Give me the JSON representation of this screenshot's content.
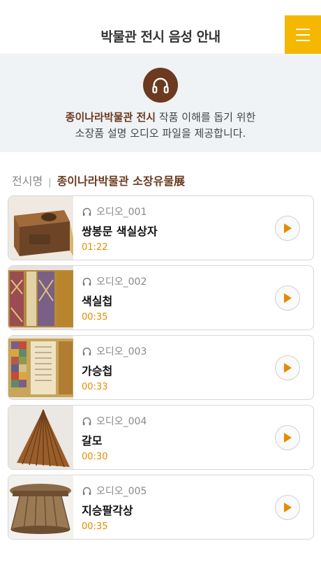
{
  "header": {
    "title": "박물관 전시 음성 안내",
    "menu_icon": "hamburger-menu-icon"
  },
  "intro": {
    "icon": "headphones-icon",
    "highlight": "종이나라박물관 전시",
    "line1_rest": " 작품 이해를 돕기 위한",
    "line2": "소장품 설명 오디오 파일을 제공합니다."
  },
  "exhibit": {
    "label": "전시명",
    "separator": "|",
    "value": "종이나라박물관 소장유물展"
  },
  "colors": {
    "accent": "#f5b700",
    "brand_brown": "#6b3a20",
    "time_orange": "#e58b00"
  },
  "items": [
    {
      "audio": "오디오_001",
      "title": "쌍봉문 색실상자",
      "duration": "01:22"
    },
    {
      "audio": "오디오_002",
      "title": "색실첩",
      "duration": "00:35"
    },
    {
      "audio": "오디오_003",
      "title": "가승첩",
      "duration": "00:33"
    },
    {
      "audio": "오디오_004",
      "title": "갈모",
      "duration": "00:30"
    },
    {
      "audio": "오디오_005",
      "title": "지승팔각상",
      "duration": "00:35"
    }
  ]
}
